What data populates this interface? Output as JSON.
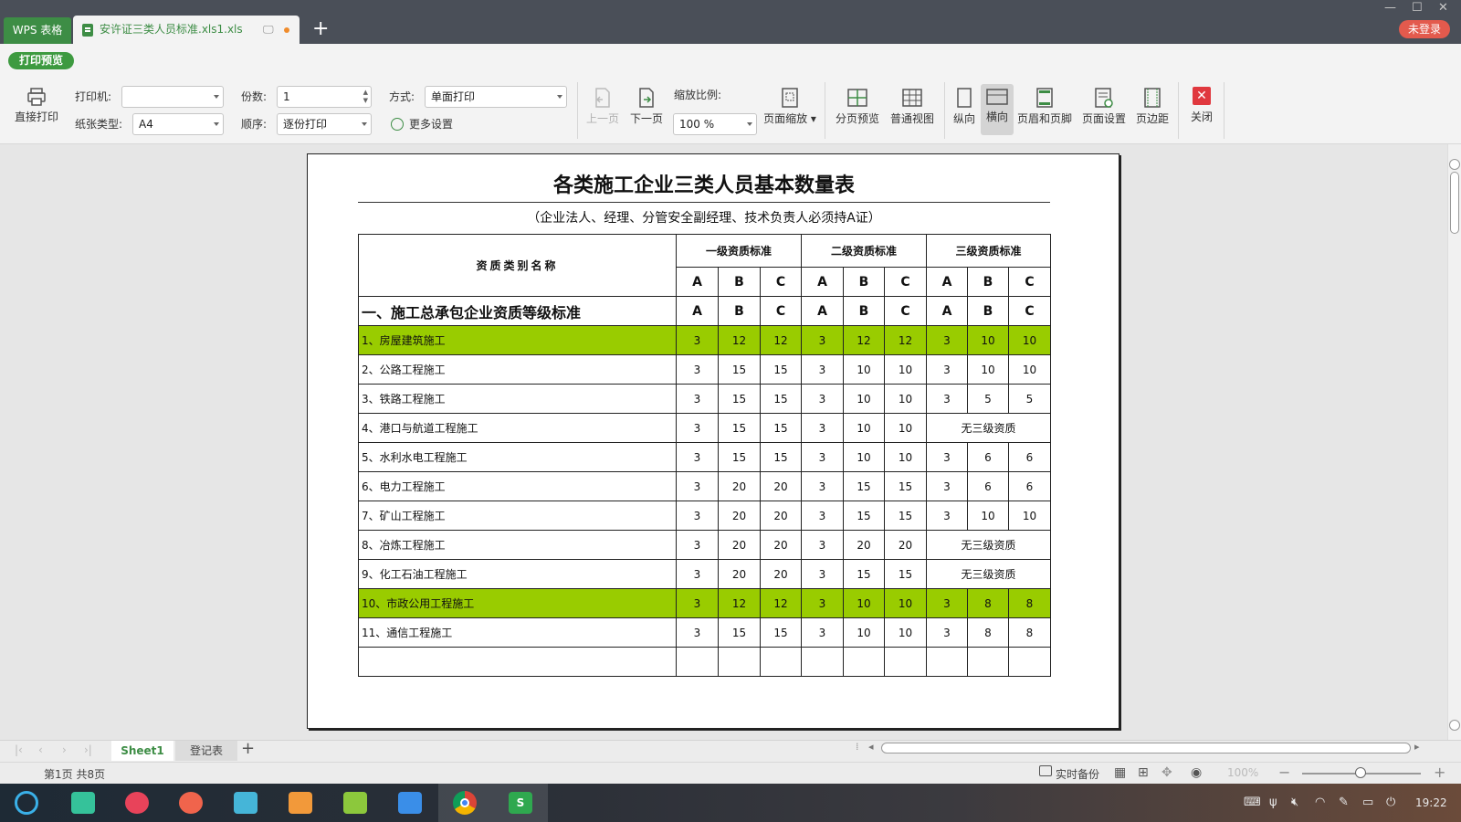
{
  "titlebar": {
    "app_tab": "WPS 表格",
    "doc_tab": "安许证三类人员标准.xls1.xls",
    "new_tab": "+",
    "login": "未登录"
  },
  "toolbar": {
    "print_preview_badge": "打印预览",
    "direct_print": "直接打印",
    "printer_label": "打印机:",
    "printer_value": "",
    "paper_label": "纸张类型:",
    "paper_value": "A4",
    "copies_label": "份数:",
    "copies_value": "1",
    "order_label": "顺序:",
    "order_value": "逐份打印",
    "mode_label": "方式:",
    "mode_value": "单面打印",
    "more_settings": "更多设置",
    "prev_page": "上一页",
    "next_page": "下一页",
    "zoom_label": "缩放比例:",
    "zoom_value": "100 %",
    "page_zoom": "页面缩放",
    "page_break_preview": "分页预览",
    "normal_view": "普通视图",
    "portrait": "纵向",
    "landscape": "横向",
    "header_footer": "页眉和页脚",
    "page_setup": "页面设置",
    "margins": "页边距",
    "close": "关闭"
  },
  "sheet": {
    "title": "各类施工企业三类人员基本数量表",
    "subtitle": "（企业法人、经理、分管安全副经理、技术负责人必须持A证）",
    "header_name": "资质类别名称",
    "level_headers": [
      "一级资质标准",
      "二级资质标准",
      "三级资质标准"
    ],
    "abc": [
      "A",
      "B",
      "C",
      "A",
      "B",
      "C",
      "A",
      "B",
      "C"
    ],
    "category_label": "一、施工总承包企业资质等级标准",
    "rows": [
      {
        "name": "1、房屋建筑施工",
        "values": [
          "3",
          "12",
          "12",
          "3",
          "12",
          "12",
          "3",
          "10",
          "10"
        ],
        "highlight": true
      },
      {
        "name": "2、公路工程施工",
        "values": [
          "3",
          "15",
          "15",
          "3",
          "10",
          "10",
          "3",
          "10",
          "10"
        ],
        "highlight": false
      },
      {
        "name": "3、铁路工程施工",
        "values": [
          "3",
          "15",
          "15",
          "3",
          "10",
          "10",
          "3",
          "5",
          "5"
        ],
        "highlight": false
      },
      {
        "name": "4、港口与航道工程施工",
        "values": [
          "3",
          "15",
          "15",
          "3",
          "10",
          "10"
        ],
        "merged_text": "无三级资质",
        "highlight": false
      },
      {
        "name": "5、水利水电工程施工",
        "values": [
          "3",
          "15",
          "15",
          "3",
          "10",
          "10",
          "3",
          "6",
          "6"
        ],
        "highlight": false
      },
      {
        "name": "6、电力工程施工",
        "values": [
          "3",
          "20",
          "20",
          "3",
          "15",
          "15",
          "3",
          "6",
          "6"
        ],
        "highlight": false
      },
      {
        "name": "7、矿山工程施工",
        "values": [
          "3",
          "20",
          "20",
          "3",
          "15",
          "15",
          "3",
          "10",
          "10"
        ],
        "highlight": false
      },
      {
        "name": "8、冶炼工程施工",
        "values": [
          "3",
          "20",
          "20",
          "3",
          "20",
          "20"
        ],
        "merged_text": "无三级资质",
        "highlight": false
      },
      {
        "name": "9、化工石油工程施工",
        "values": [
          "3",
          "20",
          "20",
          "3",
          "15",
          "15"
        ],
        "merged_text": "无三级资质",
        "highlight": false
      },
      {
        "name": "10、市政公用工程施工",
        "values": [
          "3",
          "12",
          "12",
          "3",
          "10",
          "10",
          "3",
          "8",
          "8"
        ],
        "highlight": true
      },
      {
        "name": "11、通信工程施工",
        "values": [
          "3",
          "15",
          "15",
          "3",
          "10",
          "10",
          "3",
          "8",
          "8"
        ],
        "highlight": false
      },
      {
        "name": "",
        "values": [
          "",
          "",
          "",
          "",
          "",
          "",
          "",
          "",
          ""
        ],
        "highlight": false
      }
    ]
  },
  "sheet_tabs": [
    "Sheet1",
    "登记表"
  ],
  "status": {
    "page_info": "第1页 共8页",
    "backup": "实时备份",
    "zoom": "100%"
  },
  "taskbar": {
    "time": "19:22"
  },
  "colors": {
    "titlebar_bg": "#4a4f58",
    "wps_green": "#3d8d45",
    "row_highlight": "#99cc00",
    "login_red": "#e35a4d"
  }
}
